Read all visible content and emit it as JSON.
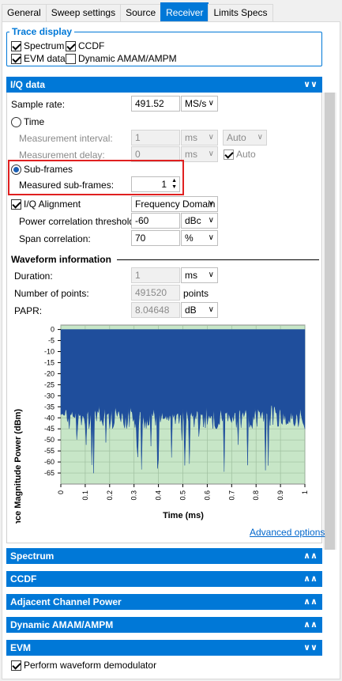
{
  "tabs": [
    "General",
    "Sweep settings",
    "Source",
    "Receiver",
    "Limits Specs"
  ],
  "trace_display": {
    "title": "Trace display",
    "spectrum": "Spectrum",
    "ccdf": "CCDF",
    "evm": "EVM data",
    "dynamic": "Dynamic AMAM/AMPM"
  },
  "iq": {
    "header": "I/Q data",
    "sample_rate_label": "Sample rate:",
    "sample_rate_value": "491.52",
    "sample_rate_unit": "MS/s",
    "time_label": "Time",
    "meas_interval_label": "Measurement interval:",
    "meas_interval_value": "1",
    "meas_interval_unit": "ms",
    "meas_interval_mode": "Auto",
    "meas_delay_label": "Measurement delay:",
    "meas_delay_value": "0",
    "meas_delay_unit": "ms",
    "auto_label": "Auto",
    "subframes_label": "Sub-frames",
    "measured_subframes_label": "Measured sub-frames:",
    "measured_subframes_value": "1",
    "iq_alignment_label": "I/Q Alignment",
    "iq_alignment_value": "Frequency Domain",
    "power_corr_label": "Power correlation threshold:",
    "power_corr_value": "-60",
    "power_corr_unit": "dBc",
    "span_corr_label": "Span correlation:",
    "span_corr_value": "70",
    "span_corr_unit": "%",
    "waveform_info_title": "Waveform information",
    "duration_label": "Duration:",
    "duration_value": "1",
    "duration_unit": "ms",
    "num_points_label": "Number of points:",
    "num_points_value": "491520",
    "num_points_unit": "points",
    "papr_label": "PAPR:",
    "papr_value": "8.04648",
    "papr_unit": "dB",
    "advanced_options": "Advanced options"
  },
  "sections": {
    "spectrum": "Spectrum",
    "ccdf": "CCDF",
    "acp": "Adjacent Channel Power",
    "dynamic": "Dynamic AMAM/AMPM",
    "evm": "EVM",
    "perform_demod": "Perform waveform demodulator"
  },
  "colors": {
    "accent": "#0078d7",
    "plot_bg": "#c7e6c7",
    "trace": "#1f4e9c",
    "highlight": "#e02020"
  },
  "chart_data": {
    "type": "area",
    "xlabel": "Time (ms)",
    "ylabel": "Reference Magnitude Power (dBm)",
    "xlim": [
      0,
      1
    ],
    "ylim": [
      -70,
      2
    ],
    "x_ticks": [
      "0",
      "0.1",
      "0.2",
      "0.3",
      "0.4",
      "0.5",
      "0.6",
      "0.7",
      "0.8",
      "0.9",
      "1"
    ],
    "y_ticks": [
      "0",
      "-5",
      "-10",
      "-15",
      "-20",
      "-25",
      "-30",
      "-35",
      "-40",
      "-45",
      "-50",
      "-55",
      "-60",
      "-65"
    ],
    "series": [
      {
        "envelope_max": 0,
        "typical_min": -41,
        "deep_min": -66
      }
    ],
    "grid": true
  }
}
